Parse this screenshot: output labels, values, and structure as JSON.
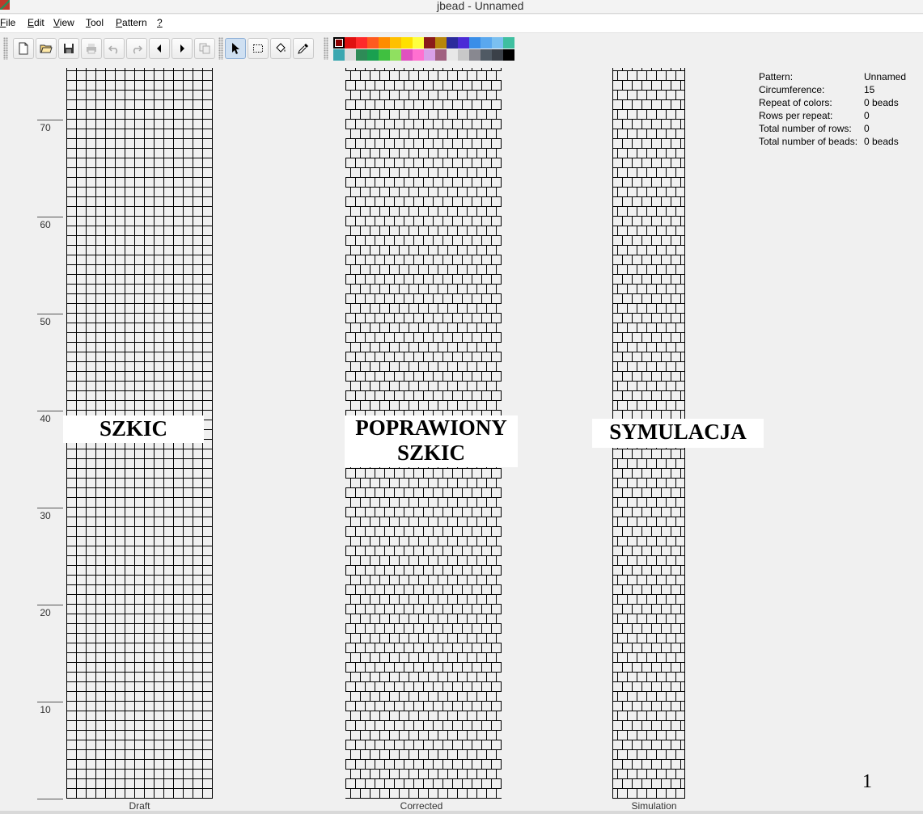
{
  "window": {
    "title": "jbead - Unnamed"
  },
  "menu": [
    {
      "label": "File",
      "mnemonic": "F"
    },
    {
      "label": "Edit",
      "mnemonic": "E"
    },
    {
      "label": "View",
      "mnemonic": "V"
    },
    {
      "label": "Tool",
      "mnemonic": "T"
    },
    {
      "label": "Pattern",
      "mnemonic": "P"
    },
    {
      "label": "?",
      "mnemonic": "?"
    }
  ],
  "toolbar": {
    "buttons": [
      {
        "name": "new-file",
        "icon": "new-file-icon"
      },
      {
        "name": "open-file",
        "icon": "folder-open-icon"
      },
      {
        "name": "save-file",
        "icon": "save-icon"
      },
      {
        "name": "print",
        "icon": "printer-icon"
      },
      {
        "name": "undo",
        "icon": "undo-icon"
      },
      {
        "name": "redo",
        "icon": "redo-icon"
      },
      {
        "name": "shift-left",
        "icon": "arrow-left-icon"
      },
      {
        "name": "shift-right",
        "icon": "arrow-right-icon"
      },
      {
        "name": "copy-pattern",
        "icon": "copy-icon"
      },
      {
        "name": "pencil-tool",
        "icon": "pointer-icon",
        "active": true
      },
      {
        "name": "select-tool",
        "icon": "selection-rect-icon"
      },
      {
        "name": "fill-tool",
        "icon": "paint-bucket-icon"
      },
      {
        "name": "pipette-tool",
        "icon": "eyedropper-icon"
      }
    ]
  },
  "palette": {
    "selected_index": 0,
    "colors": [
      "#8b0000",
      "#e01010",
      "#ff2a2a",
      "#ff5a1f",
      "#ff8c00",
      "#ffc000",
      "#ffe000",
      "#ffff40",
      "#8b1a1a",
      "#b8860b",
      "#2b2b9c",
      "#4b2bd6",
      "#3a8ee8",
      "#5aa8ee",
      "#7bc0f0",
      "#3fbfa0",
      "#3aa7b0",
      "#dddddd",
      "#2e8b57",
      "#1aa050",
      "#40c040",
      "#90e060",
      "#e050c0",
      "#ff70d0",
      "#d8a0e8",
      "#a06080",
      "#e8e8e8",
      "#c8c8c8",
      "#888890",
      "#505a64",
      "#3a4048",
      "#000000"
    ]
  },
  "ruler": {
    "labels": [
      "70",
      "60",
      "50",
      "40",
      "30",
      "20",
      "10"
    ]
  },
  "panels": {
    "draft": {
      "caption": "Draft",
      "overlay": "SZKIC"
    },
    "corrected": {
      "caption": "Corrected",
      "overlay_line1": "POPRAWIONY",
      "overlay_line2": "SZKIC"
    },
    "simulation": {
      "caption": "Simulation",
      "overlay": "SYMULACJA"
    }
  },
  "info": [
    {
      "label": "Pattern:",
      "value": "Unnamed"
    },
    {
      "label": "Circumference:",
      "value": "15"
    },
    {
      "label": "Repeat of colors:",
      "value": "0 beads"
    },
    {
      "label": "Rows per repeat:",
      "value": "0"
    },
    {
      "label": "Total number of rows:",
      "value": "0"
    },
    {
      "label": "Total number of beads:",
      "value": "0 beads"
    }
  ],
  "page_number": "1"
}
